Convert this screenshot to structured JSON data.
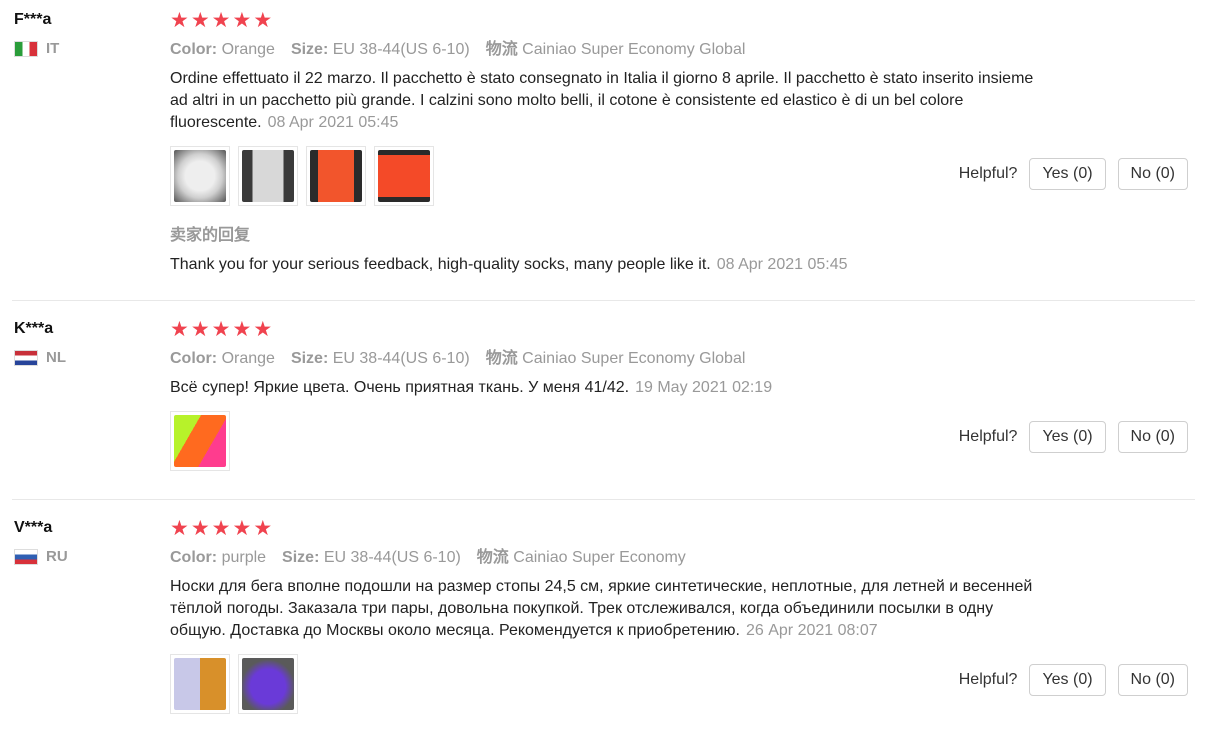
{
  "labels": {
    "color": "Color:",
    "size": "Size:",
    "shipping": "物流",
    "helpful": "Helpful?",
    "seller_reply": "卖家的回复"
  },
  "reviews": [
    {
      "user": "F***a",
      "country": "IT",
      "stars": 5,
      "color": "Orange",
      "size": "EU 38-44(US 6-10)",
      "shipping": "Cainiao Super Economy Global",
      "text": "Ordine effettuato il 22 marzo. Il pacchetto è stato consegnato in Italia il giorno 8 aprile. Il pacchetto è stato inserito insieme ad altri in un pacchetto più grande. I calzini sono molto belli, il cotone è consistente ed elastico è di un bel colore fluorescente.",
      "date": "08 Apr 2021 05:45",
      "yes": "Yes (0)",
      "no": "No (0)",
      "reply_text": "Thank you for your serious feedback, high-quality socks, many people like it.",
      "reply_date": "08 Apr 2021 05:45"
    },
    {
      "user": "K***a",
      "country": "NL",
      "stars": 5,
      "color": "Orange",
      "size": "EU 38-44(US 6-10)",
      "shipping": "Cainiao Super Economy Global",
      "text": "Всё супер! Яркие цвета. Очень приятная ткань. У меня 41/42.",
      "date": "19 May 2021 02:19",
      "yes": "Yes (0)",
      "no": "No (0)"
    },
    {
      "user": "V***a",
      "country": "RU",
      "stars": 5,
      "color": "purple",
      "size": "EU 38-44(US 6-10)",
      "shipping": "Cainiao Super Economy",
      "text": "Носки для бега вполне подошли на размер стопы 24,5 см, яркие синтетические, неплотные, для летней и весенней тёплой погоды. Заказала три пары, довольна покупкой. Трек отслеживался, когда объединили посылки в одну общую. Доставка до Москвы около месяца. Рекомендуется к приобретению.",
      "date": "26 Apr 2021 08:07",
      "yes": "Yes (0)",
      "no": "No (0)"
    }
  ],
  "colors": {
    "star": "#f0434f",
    "muted": "#999999",
    "text": "#222222"
  }
}
